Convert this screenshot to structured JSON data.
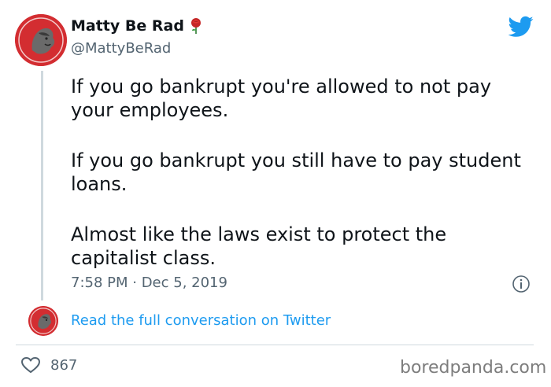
{
  "tweet": {
    "display_name": "Matty Be Rad",
    "name_emoji_icon": "rose-icon",
    "handle": "@MattyBeRad",
    "paragraphs": [
      "If you go bankrupt you're allowed to not pay your employees.",
      "If you go bankrupt you still have to pay student loans.",
      "Almost like the laws exist to protect the capitalist class."
    ],
    "timestamp": "7:58 PM · Dec 5, 2019",
    "read_more": "Read the full conversation on Twitter",
    "likes": "867"
  },
  "watermark": "boredpanda.com",
  "colors": {
    "link": "#1d9bf0",
    "twitter_blue": "#1d9bf0",
    "avatar_red": "#d32d31",
    "muted": "#536471"
  }
}
